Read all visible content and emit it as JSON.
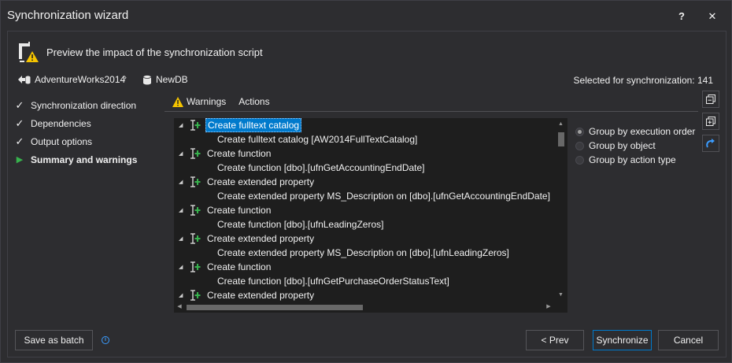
{
  "window": {
    "title": "Synchronization wizard",
    "help_glyph": "?",
    "close_glyph": "✕"
  },
  "header": {
    "text": "Preview the impact of the synchronization script",
    "icon": "database-warning-icon"
  },
  "connection": {
    "source": "AdventureWorks2014",
    "separator": "›",
    "target": "NewDB",
    "selected_label": "Selected for synchronization: 141"
  },
  "steps": [
    {
      "label": "Synchronization direction",
      "state": "done"
    },
    {
      "label": "Dependencies",
      "state": "done"
    },
    {
      "label": "Output options",
      "state": "done"
    },
    {
      "label": "Summary and warnings",
      "state": "current"
    }
  ],
  "step_glyphs": {
    "done": "✓",
    "current": "▶"
  },
  "tabs": {
    "warnings": "Warnings",
    "actions": "Actions"
  },
  "actions_list": [
    {
      "kind": "parent",
      "text": "Create fulltext catalog",
      "selected": true
    },
    {
      "kind": "child",
      "text": "Create fulltext catalog [AW2014FullTextCatalog]"
    },
    {
      "kind": "parent",
      "text": "Create function"
    },
    {
      "kind": "child",
      "text": "Create function [dbo].[ufnGetAccountingEndDate]"
    },
    {
      "kind": "parent",
      "text": "Create extended property"
    },
    {
      "kind": "child",
      "text": "Create extended property MS_Description on [dbo].[ufnGetAccountingEndDate]"
    },
    {
      "kind": "parent",
      "text": "Create function"
    },
    {
      "kind": "child",
      "text": "Create function [dbo].[ufnLeadingZeros]"
    },
    {
      "kind": "parent",
      "text": "Create extended property"
    },
    {
      "kind": "child",
      "text": "Create extended property MS_Description on [dbo].[ufnLeadingZeros]"
    },
    {
      "kind": "parent",
      "text": "Create function"
    },
    {
      "kind": "child",
      "text": "Create function [dbo].[ufnGetPurchaseOrderStatusText]"
    },
    {
      "kind": "parent",
      "text": "Create extended property"
    }
  ],
  "grouping": {
    "options": [
      {
        "label": "Group by execution order",
        "checked": true
      },
      {
        "label": "Group by object",
        "checked": false
      },
      {
        "label": "Group by action type",
        "checked": false
      }
    ]
  },
  "footer": {
    "save_batch": "Save as batch",
    "prev": "< Prev",
    "synchronize": "Synchronize",
    "cancel": "Cancel",
    "info_glyph": "i"
  },
  "colors": {
    "background": "#2d2d30",
    "list_background": "#1e1e1e",
    "selection": "#007acc",
    "accent_green": "#37b24d",
    "warning_yellow": "#f5c400"
  }
}
